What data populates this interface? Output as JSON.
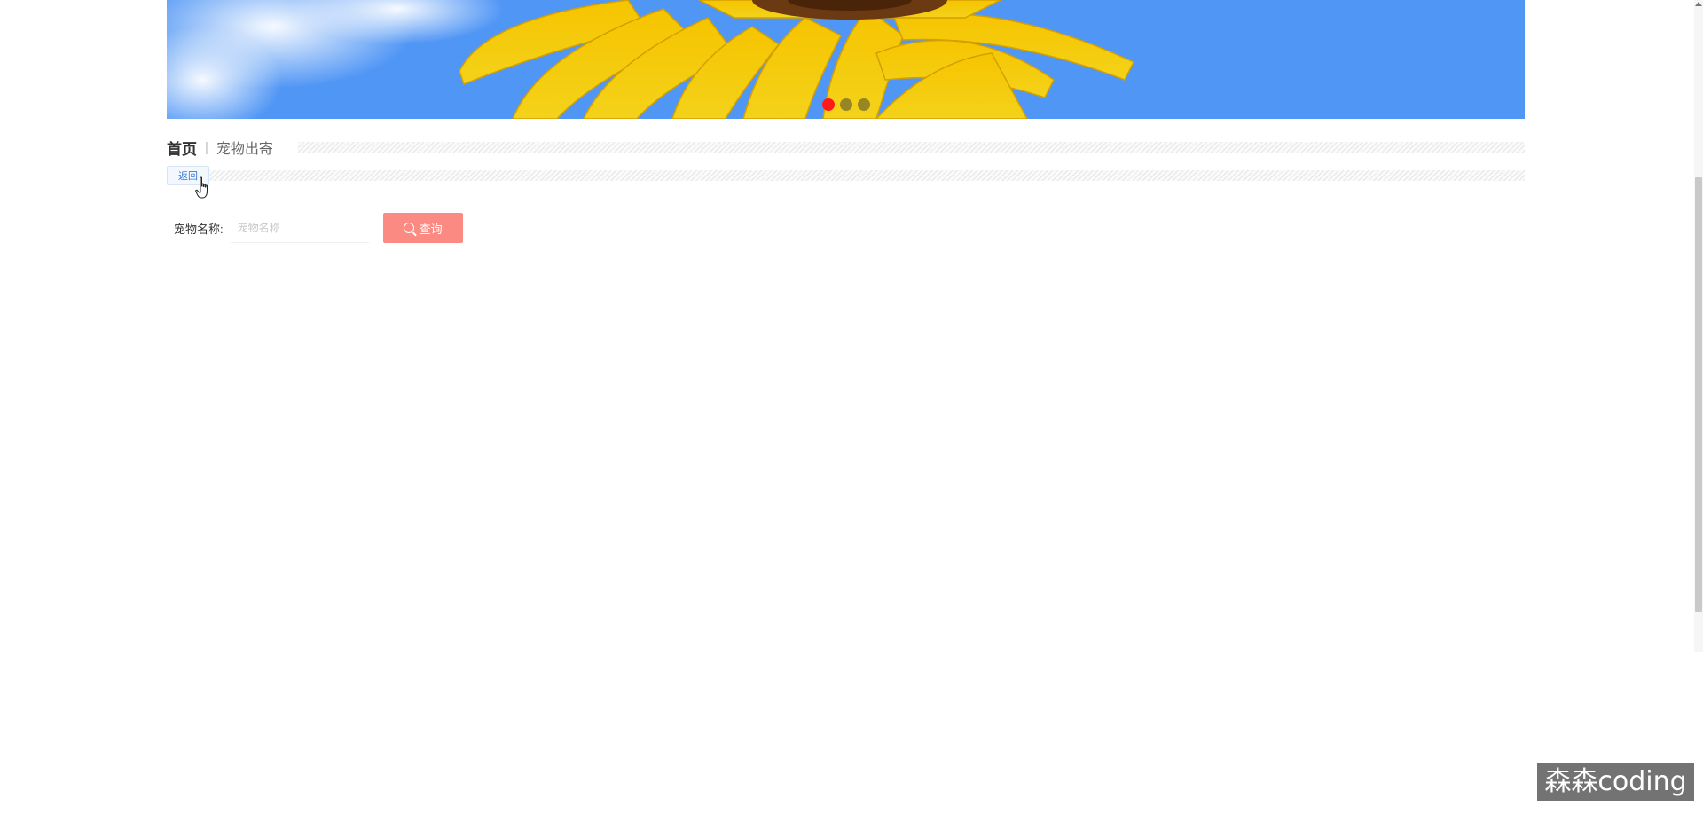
{
  "banner": {
    "dots": [
      {
        "active": true
      },
      {
        "active": false
      },
      {
        "active": false
      }
    ]
  },
  "breadcrumb": {
    "home": "首页",
    "separator": "|",
    "current": "宠物出寄"
  },
  "back": {
    "label": "返回"
  },
  "search": {
    "label": "宠物名称:",
    "placeholder": "宠物名称",
    "value": "",
    "button_label": "查询"
  },
  "colors": {
    "accent_button": "#fb8a82",
    "active_dot": "#ff1a1a",
    "sky": "#5096f5",
    "back_text": "#3b7ad9"
  },
  "watermark": {
    "text": "森森coding"
  }
}
